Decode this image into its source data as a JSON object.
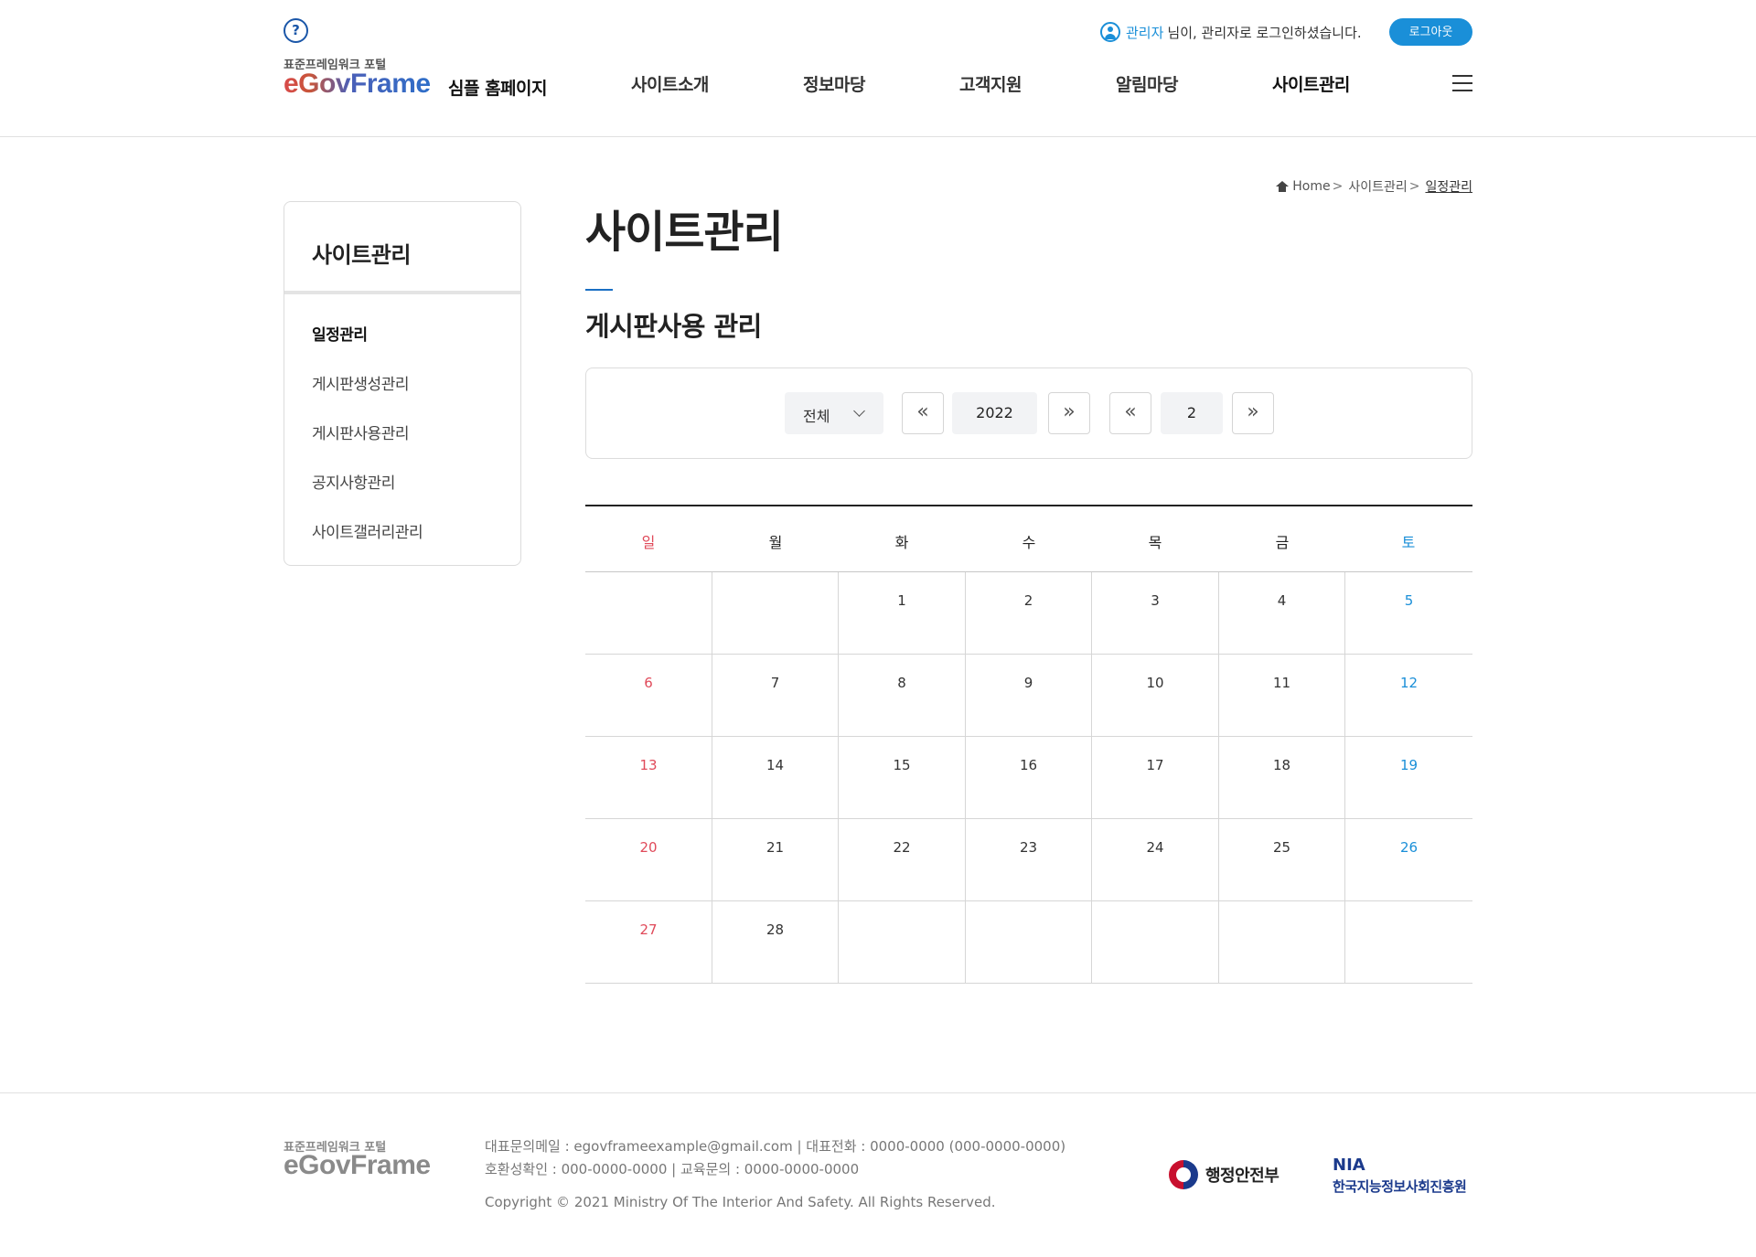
{
  "header": {
    "help_icon": "question-circle-icon",
    "logo_sub": "표준프레임워크 포털",
    "logo_main": "eGovFrame",
    "logo_simple": "심플 홈페이지",
    "nav": [
      "사이트소개",
      "정보마당",
      "고객지원",
      "알림마당",
      "사이트관리"
    ],
    "active_nav": "사이트관리",
    "user_name": "관리자",
    "user_msg": "님이, 관리자로 로그인하셨습니다.",
    "logout_label": "로그아웃",
    "menu_icon": "hamburger-menu-icon",
    "accent_color": "#1a8fd8"
  },
  "sidebar": {
    "title": "사이트관리",
    "items": [
      "일정관리",
      "게시판생성관리",
      "게시판사용관리",
      "공지사항관리",
      "사이트갤러리관리"
    ],
    "active_item": "일정관리"
  },
  "breadcrumb": {
    "home_icon": "home-icon",
    "home": "Home",
    "separator": ">",
    "section": "사이트관리",
    "current": "일정관리"
  },
  "page": {
    "title": "사이트관리",
    "subtitle": "게시판사용 관리"
  },
  "search": {
    "select_value": "전체",
    "year": "2022",
    "month": "2",
    "prev_icon": "«",
    "next_icon": "»"
  },
  "calendar": {
    "days": [
      "일",
      "월",
      "화",
      "수",
      "목",
      "금",
      "토"
    ],
    "weeks": [
      [
        "",
        "",
        "1",
        "2",
        "3",
        "4",
        "5"
      ],
      [
        "6",
        "7",
        "8",
        "9",
        "10",
        "11",
        "12"
      ],
      [
        "13",
        "14",
        "15",
        "16",
        "17",
        "18",
        "19"
      ],
      [
        "20",
        "21",
        "22",
        "23",
        "24",
        "25",
        "26"
      ],
      [
        "27",
        "28",
        "",
        "",
        "",
        "",
        ""
      ]
    ],
    "sunday_color": "#e04a5a",
    "saturday_color": "#1a8fd8"
  },
  "footer": {
    "logo_sub": "표준프레임워크 포털",
    "logo_main": "eGovFrame",
    "info_line1": "대표문의메일 : egovframeexample@gmail.com | 대표전화 : 0000-0000 (000-0000-0000)",
    "info_line2": "호환성확인 : 000-0000-0000 | 교육문의 : 0000-0000-0000",
    "copyright": "Copyright © 2021 Ministry Of The Interior And Safety. All Rights Reserved.",
    "mois_label": "행정안전부",
    "nia_mark": "NIA",
    "nia_label": "한국지능정보사회진흥원"
  }
}
